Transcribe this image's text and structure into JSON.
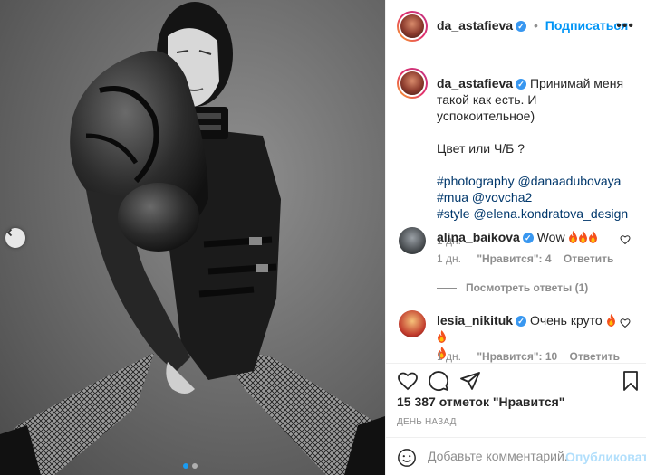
{
  "post": {
    "author": "da_astafieva",
    "follow_label": "Подписаться",
    "separator": "•",
    "more_label": "•••",
    "caption": {
      "line1": "Принимай меня",
      "line2": "такой как есть. И успокоительное)",
      "line3": "Цвет или Ч/Б ?",
      "tag_line1_tag": "#photography",
      "tag_line1_mention": "@danaadubovaya",
      "tag_line2_tag": "#mua",
      "tag_line2_mention": "@vovcha2",
      "tag_line3_tag": "#style",
      "tag_line3_mention": "@elena.kondratova_design",
      "time": "1 дн."
    },
    "likes_text": "15 387 отметок \"Нравится\"",
    "posted_ago": "ДЕНЬ НАЗАД"
  },
  "comments": [
    {
      "user": "alina_baikova",
      "text": "Wow",
      "time": "1 дн.",
      "likes": "\"Нравится\": 4",
      "reply_label": "Ответить",
      "view_replies": "Посмотреть ответы (1)"
    },
    {
      "user": "lesia_nikituk",
      "text": "Очень круто",
      "time": "1 дн.",
      "likes": "\"Нравится\": 10",
      "reply_label": "Ответить"
    }
  ],
  "add_comment": {
    "placeholder": "Добавьте комментарий...",
    "publish_label": "Опубликовать"
  },
  "colors": {
    "accent": "#0095f6",
    "verified": "#3897f0",
    "muted": "#8e8e8e"
  }
}
